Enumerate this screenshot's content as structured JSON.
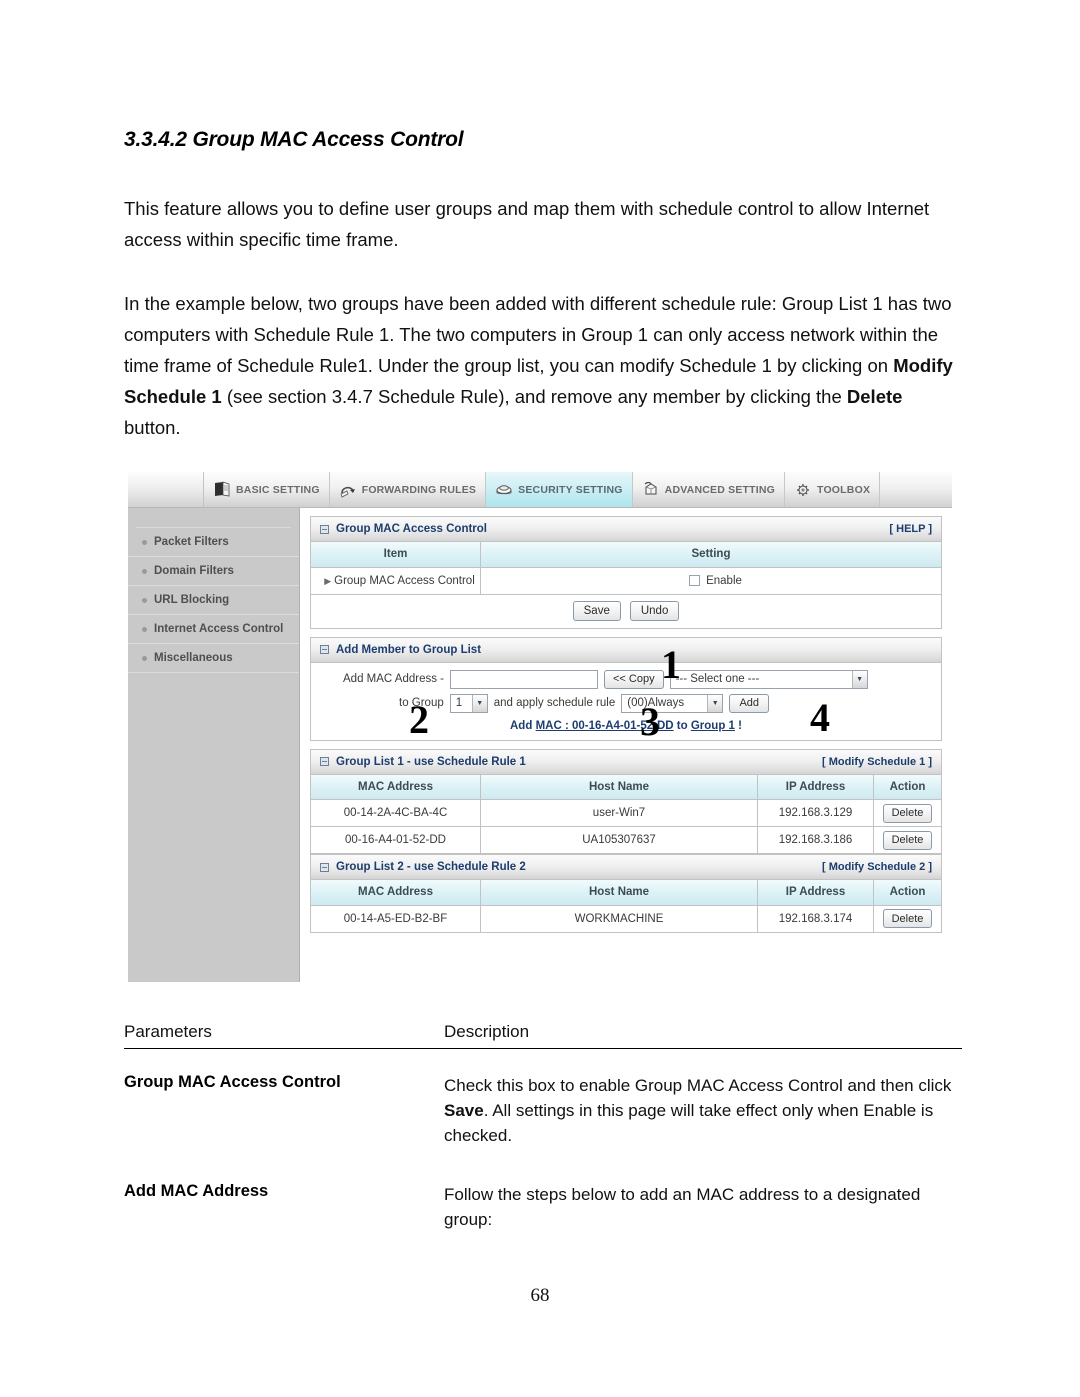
{
  "document": {
    "heading": "3.3.4.2 Group MAC Access Control",
    "paragraph1": "This feature allows you to define user groups and map them with schedule control to allow Internet access within specific time frame.",
    "paragraph2_a": "In the example below, two groups have been added with different schedule rule: Group List 1 has two computers with Schedule Rule 1. The two computers in Group 1 can only access network within the time frame of Schedule Rule1. Under the group list, you can modify Schedule 1 by clicking on ",
    "paragraph2_bold1": "Modify Schedule 1",
    "paragraph2_b": " (see section 3.4.7 Schedule Rule), and remove any member by clicking the ",
    "paragraph2_bold2": "Delete",
    "paragraph2_c": " button.",
    "page_number": "68"
  },
  "router_ui": {
    "nav_tabs": [
      {
        "label": "BASIC SETTING",
        "icon": "book-icon",
        "active": false
      },
      {
        "label": "FORWARDING RULES",
        "icon": "arrow-loop-icon",
        "active": false
      },
      {
        "label": "SECURITY SETTING",
        "icon": "shield-lock-icon",
        "active": true
      },
      {
        "label": "ADVANCED SETTING",
        "icon": "cube-icon",
        "active": false
      },
      {
        "label": "TOOLBOX",
        "icon": "gear-wrench-icon",
        "active": false
      }
    ],
    "sidebar": {
      "items": [
        {
          "label": "Packet Filters"
        },
        {
          "label": "Domain Filters"
        },
        {
          "label": "URL Blocking"
        },
        {
          "label": "Internet Access Control"
        },
        {
          "label": "Miscellaneous"
        }
      ]
    },
    "panel_main": {
      "title": "Group MAC Access Control",
      "help_label": "[ HELP ]",
      "col_item": "Item",
      "col_setting": "Setting",
      "row_item_label": "Group MAC Access Control",
      "enable_label": "Enable",
      "save_label": "Save",
      "undo_label": "Undo"
    },
    "panel_add": {
      "title": "Add Member to Group List",
      "mac_label": "Add MAC Address -",
      "mac_value": "",
      "copy_label": "<< Copy",
      "select_one": "--- Select one ---",
      "to_group_label": "to Group",
      "group_value": "1",
      "apply_label": "and apply schedule rule",
      "schedule_value": "(00)Always",
      "add_label": "Add",
      "status_prefix": "Add ",
      "status_mac": "MAC : 00-16-A4-01-52-DD",
      "status_mid": " to ",
      "status_group": "Group 1",
      "status_suffix": " !"
    },
    "callouts": [
      "1",
      "2",
      "3",
      "4"
    ],
    "group_list_1": {
      "title": "Group List 1 - use Schedule Rule 1",
      "modify_label": "[ Modify Schedule 1 ]",
      "columns": [
        "MAC Address",
        "Host Name",
        "IP Address",
        "Action"
      ],
      "rows": [
        {
          "mac": "00-14-2A-4C-BA-4C",
          "host": "user-Win7",
          "ip": "192.168.3.129",
          "action": "Delete"
        },
        {
          "mac": "00-16-A4-01-52-DD",
          "host": "UA105307637",
          "ip": "192.168.3.186",
          "action": "Delete"
        }
      ]
    },
    "group_list_2": {
      "title": "Group List 2 - use Schedule Rule 2",
      "modify_label": "[ Modify Schedule 2 ]",
      "columns": [
        "MAC Address",
        "Host Name",
        "IP Address",
        "Action"
      ],
      "rows": [
        {
          "mac": "00-14-A5-ED-B2-BF",
          "host": "WORKMACHINE",
          "ip": "192.168.3.174",
          "action": "Delete"
        }
      ]
    }
  },
  "parameters_table": {
    "header_parameters": "Parameters",
    "header_description": "Description",
    "rows": [
      {
        "parameter": "Group MAC Access Control",
        "desc_a": "Check this box to enable Group MAC Access Control and then click ",
        "desc_bold": "Save",
        "desc_b": ". All settings in this page will take effect only when Enable is checked."
      },
      {
        "parameter": "Add MAC Address",
        "desc_a": "Follow the steps below to add an MAC address to a designated group:",
        "desc_bold": "",
        "desc_b": ""
      }
    ]
  },
  "colors": {
    "heading": "#000000",
    "panel_title": "#1c3d6e",
    "nav_active_bg": "#b9e8f0",
    "table_header_bg": "#ddf2f6",
    "sidebar_bg": "#c9c9c9"
  }
}
